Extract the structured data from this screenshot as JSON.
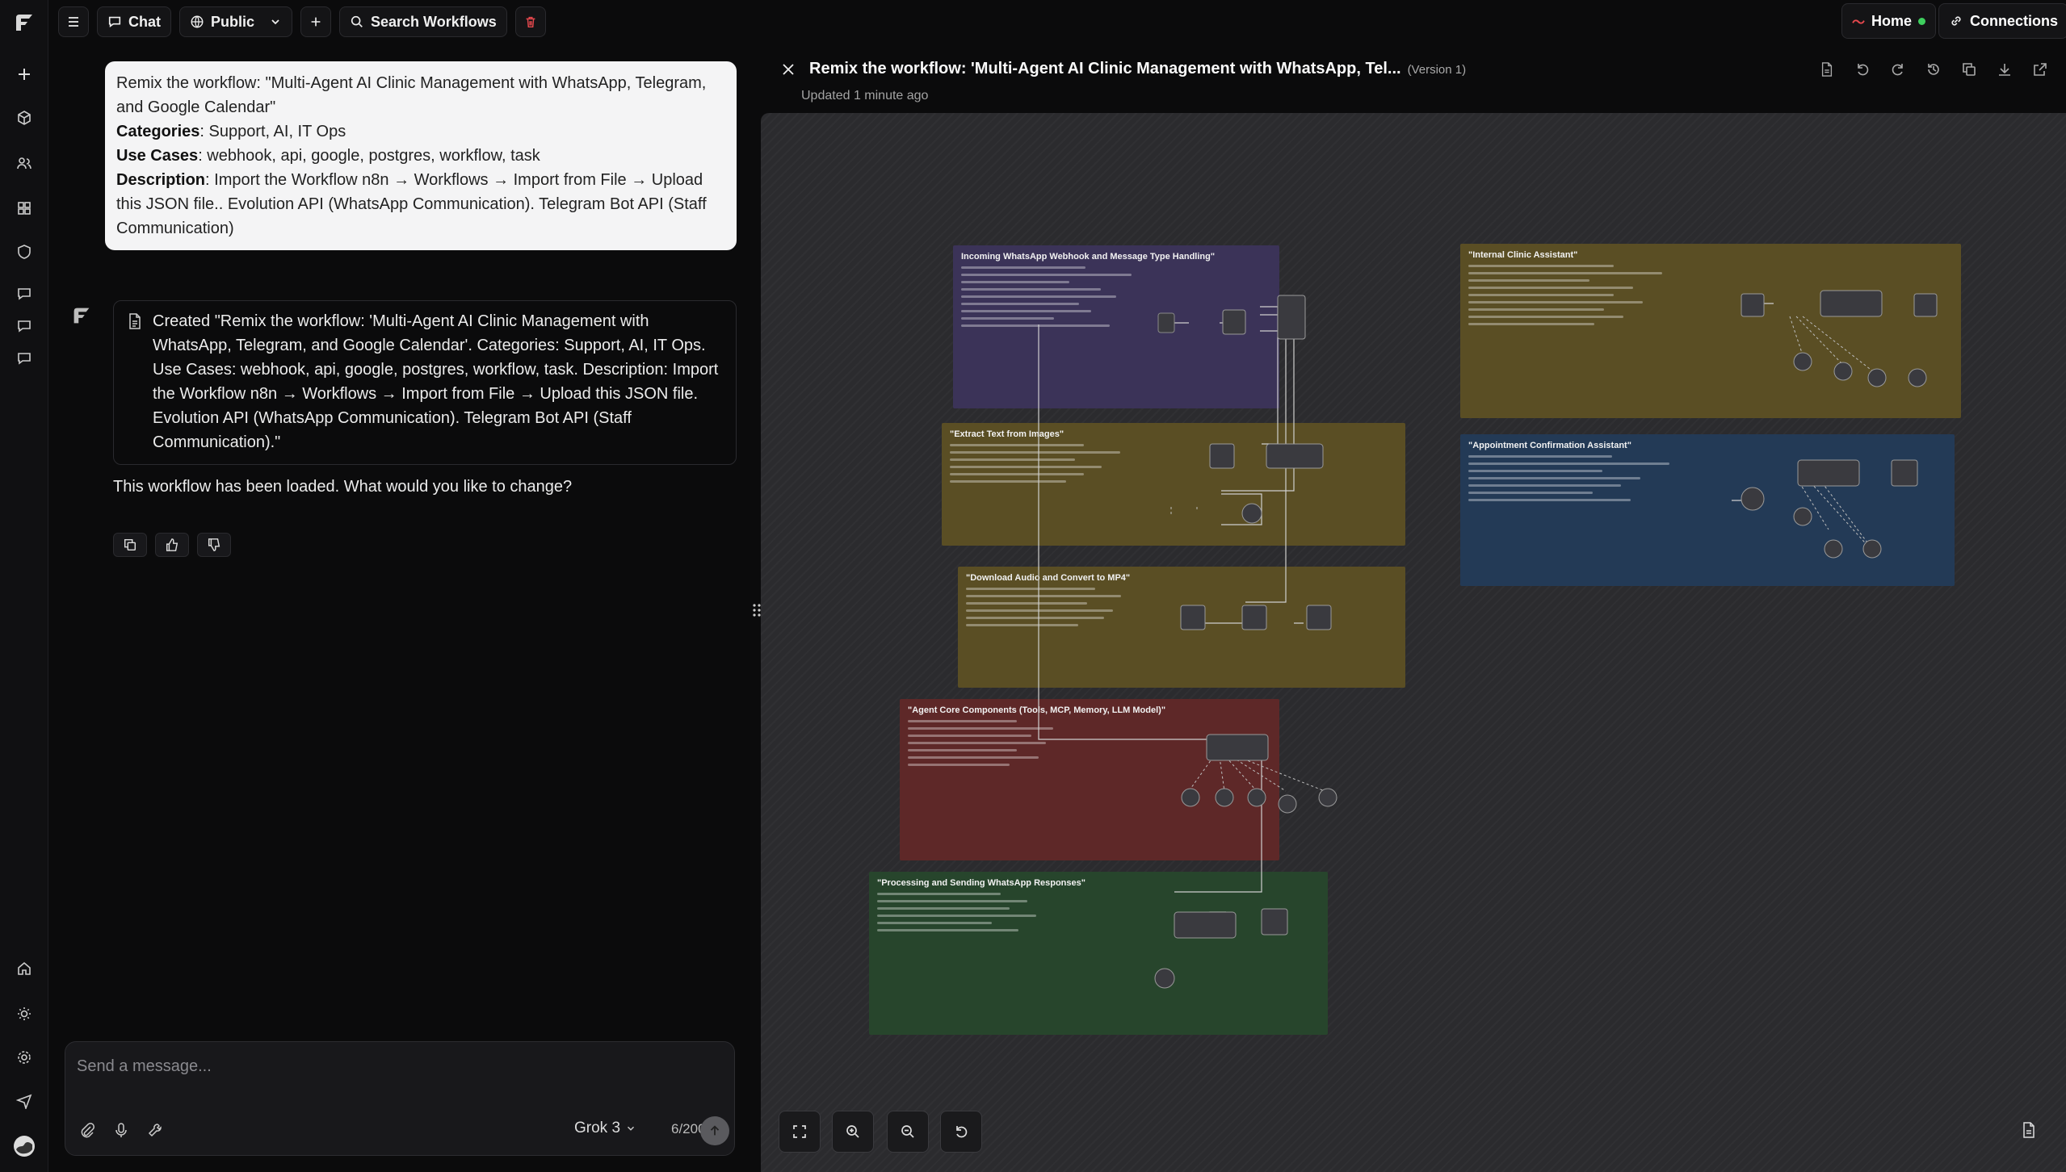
{
  "topbar": {
    "chat_label": "Chat",
    "visibility_label": "Public",
    "search_label": "Search Workflows",
    "home_label": "Home",
    "connections_label": "Connections"
  },
  "user_message": {
    "intro": "Remix the workflow: \"Multi-Agent AI Clinic Management with WhatsApp, Telegram, and Google Calendar\"",
    "categories_label": "Categories",
    "categories": ": Support, AI, IT Ops",
    "use_cases_label": "Use Cases",
    "use_cases": ": webhook, api, google, postgres, workflow, task",
    "description_label": "Description",
    "description": ": Import the Workflow n8n → Workflows → Import from File → Upload this JSON file.. Evolution API (WhatsApp Communication). Telegram Bot API (Staff Communication)"
  },
  "ai_card": {
    "text": "Created \"Remix the workflow: 'Multi-Agent AI Clinic Management with WhatsApp, Telegram, and Google Calendar'. Categories: Support, AI, IT Ops. Use Cases: webhook, api, google, postgres, workflow, task. Description: Import the Workflow n8n → Workflows → Import from File → Upload this JSON file. Evolution API (WhatsApp Communication). Telegram Bot API (Staff Communication).\""
  },
  "ai_reply": "This workflow has been loaded. What would you like to change?",
  "composer": {
    "placeholder": "Send a message...",
    "model": "Grok 3",
    "count": "6/200"
  },
  "workflow": {
    "title": "Remix the workflow: 'Multi-Agent AI Clinic Management with WhatsApp, Tel...",
    "version": "(Version 1)",
    "updated": "Updated 1 minute ago",
    "notes": [
      {
        "title": "Incoming WhatsApp Webhook and Message Type Handling\"",
        "color": "#3b3358"
      },
      {
        "title": "\"Extract Text from Images\"",
        "color": "#5a4e24"
      },
      {
        "title": "\"Download Audio and Convert to MP4\"",
        "color": "#5a4e24"
      },
      {
        "title": "\"Agent Core Components (Tools, MCP, Memory, LLM Model)\"",
        "color": "#5e2828"
      },
      {
        "title": "\"Processing and Sending WhatsApp Responses\"",
        "color": "#27452c"
      },
      {
        "title": "\"Internal Clinic Assistant\"",
        "color": "#5a4e24"
      },
      {
        "title": "\"Appointment Confirmation Assistant\"",
        "color": "#233a56"
      }
    ]
  }
}
